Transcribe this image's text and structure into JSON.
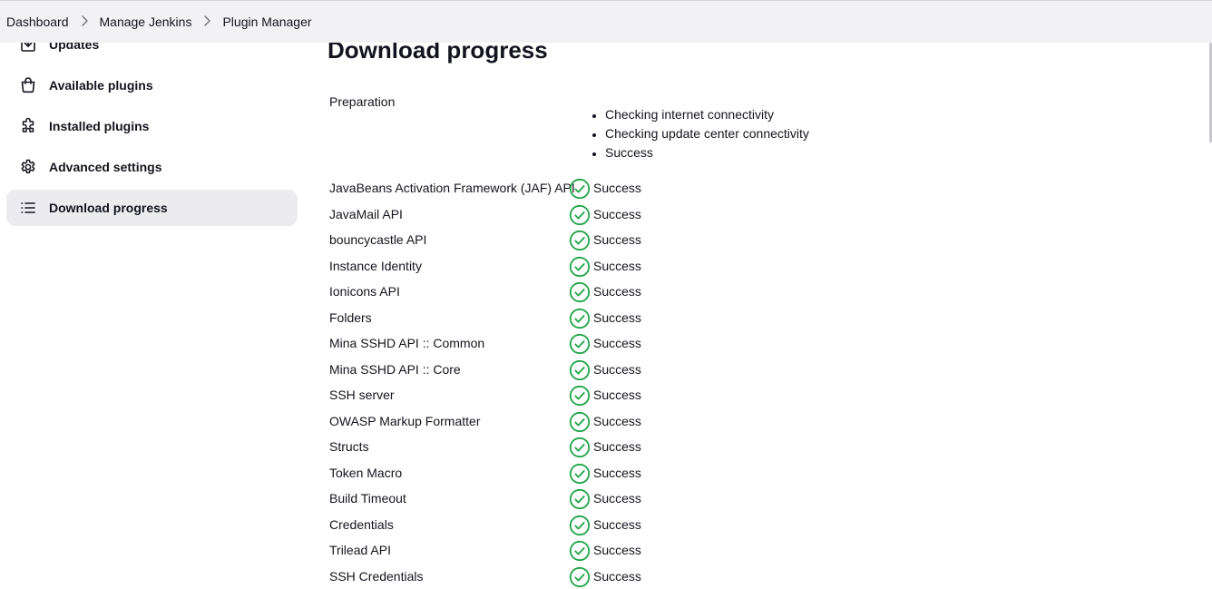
{
  "breadcrumb": {
    "items": [
      "Dashboard",
      "Manage Jenkins",
      "Plugin Manager"
    ]
  },
  "sidebar": {
    "items": [
      {
        "label": "Updates",
        "icon": "download-icon"
      },
      {
        "label": "Available plugins",
        "icon": "shopping-bag-icon"
      },
      {
        "label": "Installed plugins",
        "icon": "puzzle-icon"
      },
      {
        "label": "Advanced settings",
        "icon": "gear-icon"
      },
      {
        "label": "Download progress",
        "icon": "list-icon",
        "active": true
      }
    ]
  },
  "main": {
    "title": "Download progress",
    "preparation": {
      "label": "Preparation",
      "steps": [
        "Checking internet connectivity",
        "Checking update center connectivity",
        "Success"
      ]
    },
    "jobs": [
      {
        "name": "JavaBeans Activation Framework (JAF) API",
        "status": "Success"
      },
      {
        "name": "JavaMail API",
        "status": "Success"
      },
      {
        "name": "bouncycastle API",
        "status": "Success"
      },
      {
        "name": "Instance Identity",
        "status": "Success"
      },
      {
        "name": "Ionicons API",
        "status": "Success"
      },
      {
        "name": "Folders",
        "status": "Success"
      },
      {
        "name": "Mina SSHD API :: Common",
        "status": "Success"
      },
      {
        "name": "Mina SSHD API :: Core",
        "status": "Success"
      },
      {
        "name": "SSH server",
        "status": "Success"
      },
      {
        "name": "OWASP Markup Formatter",
        "status": "Success"
      },
      {
        "name": "Structs",
        "status": "Success"
      },
      {
        "name": "Token Macro",
        "status": "Success"
      },
      {
        "name": "Build Timeout",
        "status": "Success"
      },
      {
        "name": "Credentials",
        "status": "Success"
      },
      {
        "name": "Trilead API",
        "status": "Success"
      },
      {
        "name": "SSH Credentials",
        "status": "Success"
      }
    ]
  },
  "colors": {
    "success": "#1ea446",
    "active_bg": "#ebebf0",
    "topbar_bg": "#f2f2f4"
  }
}
